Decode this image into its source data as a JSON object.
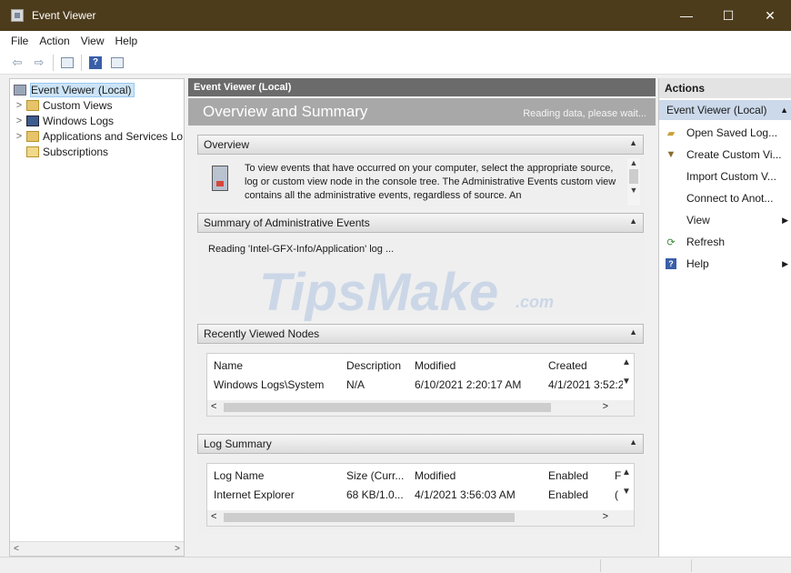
{
  "window": {
    "title": "Event Viewer",
    "controls": {
      "minimize": "—",
      "maximize": "☐",
      "close": "✕"
    }
  },
  "menu": [
    "File",
    "Action",
    "View",
    "Help"
  ],
  "toolbar": {
    "back_icon": "back-arrow-icon",
    "forward_icon": "forward-arrow-icon",
    "help_label": "?"
  },
  "tree": {
    "items": [
      {
        "label": "Event Viewer (Local)",
        "expander": "",
        "selected": true
      },
      {
        "label": "Custom Views",
        "expander": ">"
      },
      {
        "label": "Windows Logs",
        "expander": ">"
      },
      {
        "label": "Applications and Services Lo",
        "expander": ">"
      },
      {
        "label": "Subscriptions",
        "expander": ""
      }
    ],
    "scroll_left": "<",
    "scroll_right": ">"
  },
  "center": {
    "header": "Event Viewer (Local)",
    "banner_title": "Overview and Summary",
    "banner_status": "Reading data, please wait...",
    "overview": {
      "title": "Overview",
      "text": "To view events that have occurred on your computer, select the appropriate source, log or custom view node in the console tree. The Administrative Events custom view contains all the administrative events, regardless of source. An"
    },
    "summary": {
      "title": "Summary of Administrative Events",
      "text": "Reading 'Intel-GFX-Info/Application' log ..."
    },
    "recent": {
      "title": "Recently Viewed Nodes",
      "columns": [
        "Name",
        "Description",
        "Modified",
        "Created"
      ],
      "rows": [
        [
          "Windows Logs\\System",
          "N/A",
          "6/10/2021 2:20:17 AM",
          "4/1/2021 3:52:2"
        ]
      ]
    },
    "logsummary": {
      "title": "Log Summary",
      "columns": [
        "Log Name",
        "Size (Curr...",
        "Modified",
        "Enabled",
        "F"
      ],
      "rows": [
        [
          "Internet Explorer",
          "68 KB/1.0...",
          "4/1/2021 3:56:03 AM",
          "Enabled",
          "("
        ]
      ]
    },
    "watermark": {
      "main": "TipsMake",
      "suffix": ".com"
    }
  },
  "actions": {
    "header": "Actions",
    "group": "Event Viewer (Local)",
    "items": [
      {
        "label": "Open Saved Log...",
        "icon": "folder-open-icon",
        "submenu": false
      },
      {
        "label": "Create Custom Vi...",
        "icon": "filter-icon",
        "submenu": false
      },
      {
        "label": "Import Custom V...",
        "icon": "",
        "submenu": false
      },
      {
        "label": "Connect to Anot...",
        "icon": "",
        "submenu": false
      },
      {
        "label": "View",
        "icon": "",
        "submenu": true
      },
      {
        "label": "Refresh",
        "icon": "refresh-icon",
        "submenu": false
      },
      {
        "label": "Help",
        "icon": "help-icon",
        "submenu": true
      }
    ]
  }
}
